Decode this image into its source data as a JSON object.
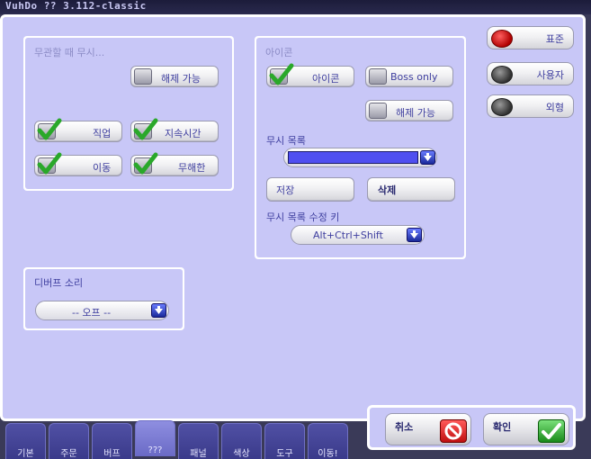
{
  "window": {
    "title": "VuhDo ?? 3.112-classic"
  },
  "ignore_section": {
    "title": "무관할 때 무시...",
    "dispellable": "해제 가능",
    "class": "직업",
    "duration": "지속시간",
    "movement": "이동",
    "harmless": "무해한"
  },
  "icon_section": {
    "title": "아이콘",
    "icon_label": "아이콘",
    "boss_only": "Boss only",
    "dispellable": "해제 가능",
    "ignore_list_label": "무시 목록",
    "save_label": "저장",
    "delete_label": "삭제",
    "modifier_label": "무시 목록 수정 키",
    "modifier_value": "Alt+Ctrl+Shift"
  },
  "debuff_sound": {
    "title": "디버프 소리",
    "value": "-- 오프 --"
  },
  "side_buttons": {
    "standard": "표준",
    "custom": "사용자",
    "appearance": "외형"
  },
  "footer": {
    "cancel": "취소",
    "ok": "확인"
  },
  "tabs": [
    {
      "label": "기본"
    },
    {
      "label": "주문"
    },
    {
      "label": "버프"
    },
    {
      "label": "???"
    },
    {
      "label": "패널"
    },
    {
      "label": "색상"
    },
    {
      "label": "도구"
    },
    {
      "label": "이동!"
    }
  ],
  "colors": {
    "panel_bg": "#c8c7f7",
    "accent_text": "#4040a0",
    "dropdown_fill": "#4f4ff0",
    "check_green": "#2aa82a"
  }
}
